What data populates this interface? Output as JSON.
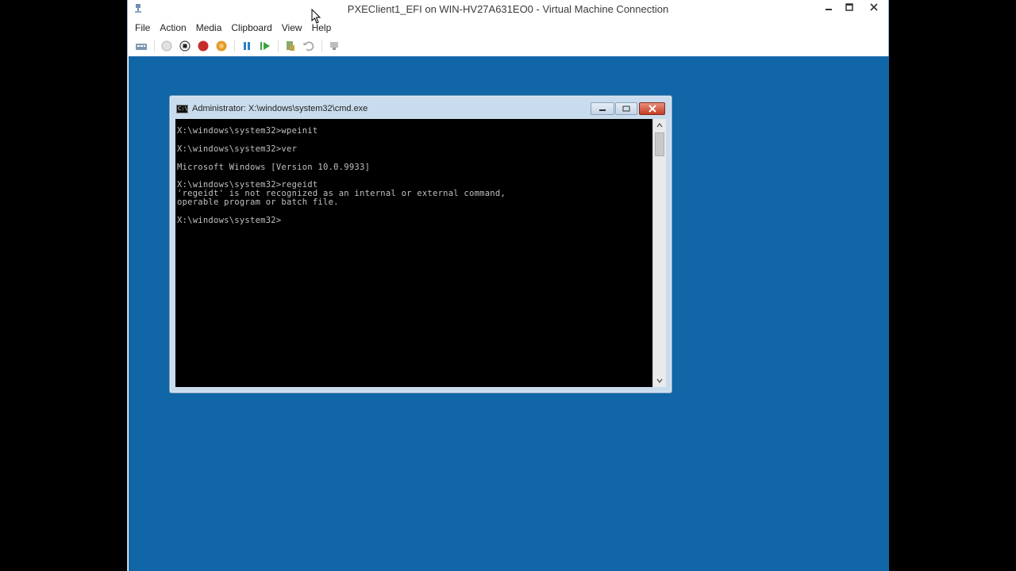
{
  "vm_window": {
    "title": "PXEClient1_EFI on WIN-HV27A631EO0 - Virtual Machine Connection",
    "menu": [
      "File",
      "Action",
      "Media",
      "Clipboard",
      "View",
      "Help"
    ],
    "toolbar_icons": [
      "ctrl-alt-del-icon",
      "start-icon",
      "turn-off-icon",
      "shut-down-icon",
      "save-icon",
      "pause-icon",
      "resume-icon",
      "checkpoint-icon",
      "revert-icon",
      "enhanced-session-icon"
    ]
  },
  "cmd_window": {
    "title": "Administrator: X:\\windows\\system32\\cmd.exe",
    "lines": [
      "X:\\windows\\system32>wpeinit",
      "",
      "X:\\windows\\system32>ver",
      "",
      "Microsoft Windows [Version 10.0.9933]",
      "",
      "X:\\windows\\system32>regeidt",
      "'regeidt' is not recognized as an internal or external command,",
      "operable program or batch file.",
      "",
      "X:\\windows\\system32>"
    ]
  },
  "colors": {
    "desktop": "#1066a7",
    "console_bg": "#000000",
    "console_text": "#c0c0c0",
    "close_button": "#c43c24"
  }
}
